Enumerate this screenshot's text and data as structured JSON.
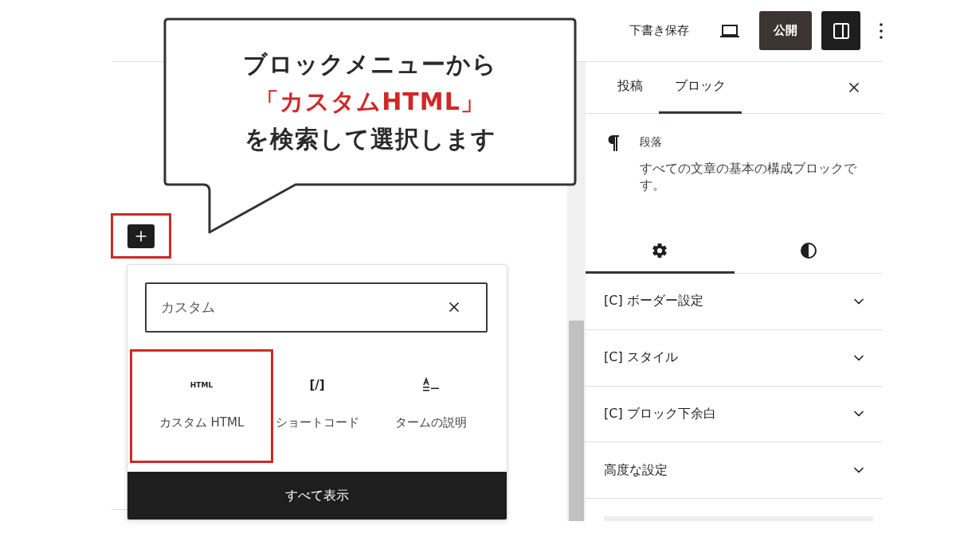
{
  "callout": {
    "lines": [
      {
        "text": "ブロックメニューから",
        "kind": "plain"
      },
      {
        "text": "「カスタムHTML」",
        "kind": "emphasis"
      },
      {
        "text": "を検索して選択します",
        "kind": "plain"
      }
    ]
  },
  "toolbar": {
    "save_draft": "下書き保存",
    "publish": "公開",
    "settings_toggle": {
      "selected": true
    }
  },
  "editor": {
    "inserter_button": {
      "highlighted": true
    }
  },
  "inserter": {
    "search": {
      "value": "カスタム"
    },
    "results": [
      {
        "label": "カスタム HTML",
        "icon": {
          "kind": "glyph",
          "text": "HTML"
        },
        "highlighted": true
      },
      {
        "label": "ショートコード",
        "icon": {
          "kind": "glyph",
          "text": "[/]"
        },
        "highlighted": false
      },
      {
        "label": "タームの説明",
        "icon": {
          "kind": "term"
        },
        "highlighted": false
      }
    ],
    "browse_all": "すべて表示"
  },
  "sidebar": {
    "tabs": [
      {
        "label": "投稿",
        "selected": false
      },
      {
        "label": "ブロック",
        "selected": true
      }
    ],
    "block": {
      "title": "段落",
      "description": "すべての文章の基本の構成ブロックです。"
    },
    "settings_tabs": [
      {
        "kind": "settings",
        "selected": true
      },
      {
        "kind": "styles",
        "selected": false
      }
    ],
    "panels": [
      {
        "title": "[C] ボーダー設定",
        "expanded": false
      },
      {
        "title": "[C] スタイル",
        "expanded": false
      },
      {
        "title": "[C] ブロック下余白",
        "expanded": false
      },
      {
        "title": "高度な設定",
        "expanded": false
      }
    ]
  }
}
